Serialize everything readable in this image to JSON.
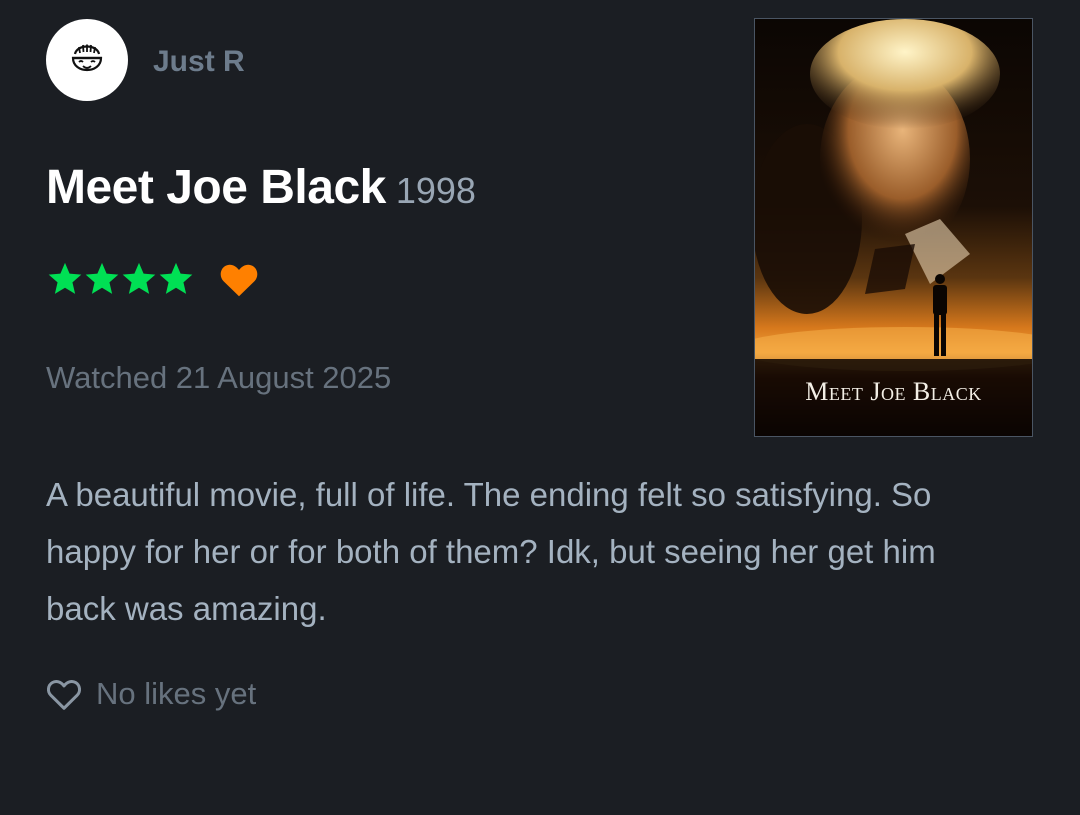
{
  "user": {
    "name": "Just R"
  },
  "film": {
    "title": "Meet Joe Black",
    "year": "1998"
  },
  "rating": {
    "stars": 4,
    "max_stars": 5,
    "liked": true,
    "star_color": "#00e054",
    "heart_color": "#ff8000"
  },
  "watched_text": "Watched 21 August 2025",
  "review_text": "A beautiful movie, full of life. The ending felt so satisfying. So happy for her or for both of them? Idk, but seeing her get him back was amazing.",
  "likes_text": "No likes yet",
  "poster": {
    "title": "Meet Joe Black"
  },
  "colors": {
    "background": "#1b1e23",
    "username": "#6d7c8c",
    "body_text": "#a4b2c0",
    "muted_text": "#67727e"
  }
}
